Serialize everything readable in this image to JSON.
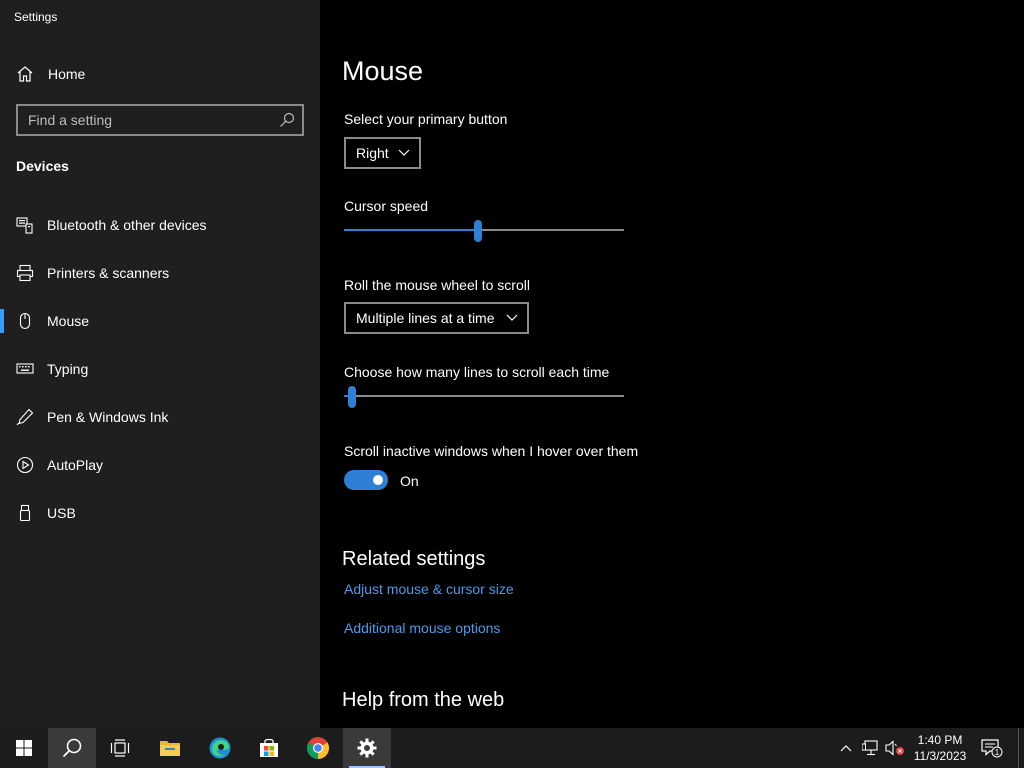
{
  "window": {
    "title": "Settings"
  },
  "sidebar": {
    "home_label": "Home",
    "search_placeholder": "Find a setting",
    "section_title": "Devices",
    "items": [
      {
        "label": "Bluetooth & other devices",
        "icon": "bluetooth-devices-icon"
      },
      {
        "label": "Printers & scanners",
        "icon": "printer-icon"
      },
      {
        "label": "Mouse",
        "icon": "mouse-icon",
        "selected": true
      },
      {
        "label": "Typing",
        "icon": "keyboard-icon"
      },
      {
        "label": "Pen & Windows Ink",
        "icon": "pen-icon"
      },
      {
        "label": "AutoPlay",
        "icon": "autoplay-icon"
      },
      {
        "label": "USB",
        "icon": "usb-icon"
      }
    ]
  },
  "main": {
    "title": "Mouse",
    "primary_button": {
      "label": "Select your primary button",
      "value": "Right"
    },
    "cursor_speed": {
      "label": "Cursor speed",
      "value_fraction": 0.48
    },
    "wheel_scroll": {
      "label": "Roll the mouse wheel to scroll",
      "value": "Multiple lines at a time"
    },
    "lines_to_scroll": {
      "label": "Choose how many lines to scroll each time",
      "value_fraction": 0.03
    },
    "scroll_inactive": {
      "label": "Scroll inactive windows when I hover over them",
      "state": "On"
    },
    "related_settings": {
      "title": "Related settings",
      "links": [
        "Adjust mouse & cursor size",
        "Additional mouse options"
      ]
    },
    "help_title": "Help from the web"
  },
  "taskbar": {
    "time": "1:40 PM",
    "date": "11/3/2023",
    "notification_count": "1"
  },
  "colors": {
    "accent": "#2f7fd6",
    "link": "#4a9bea",
    "sidebar_bg": "#1f1f1f",
    "content_bg": "#000000",
    "taskbar_bg": "#1c1c1c"
  }
}
